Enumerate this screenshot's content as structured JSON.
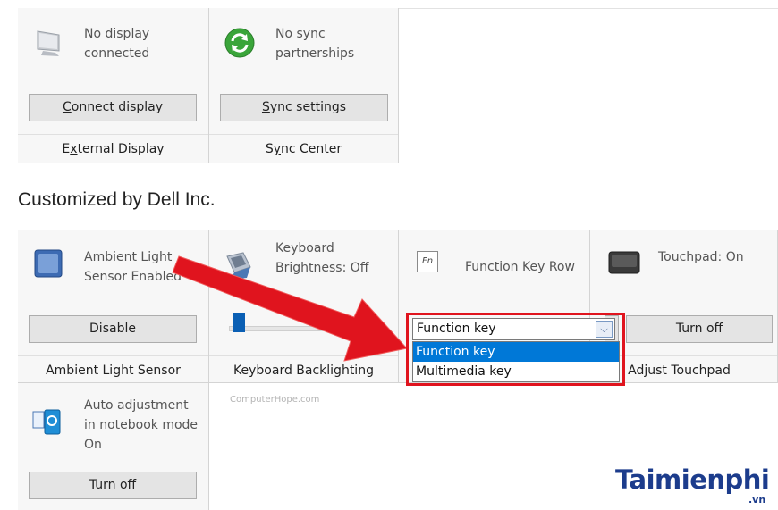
{
  "top_row": [
    {
      "status": "No display connected",
      "button": "Connect display",
      "button_access_key": "C",
      "name": "External Display",
      "name_access_key": "x",
      "icon": "monitor-icon"
    },
    {
      "status": "No sync partnerships",
      "button": "Sync settings",
      "button_access_key": "S",
      "name": "Sync Center",
      "name_access_key": "y",
      "icon": "sync-icon"
    }
  ],
  "section_title": "Customized by Dell Inc.",
  "dell_tiles": {
    "ambient": {
      "status": "Ambient Light Sensor Enabled",
      "button": "Disable",
      "name": "Ambient Light Sensor",
      "icon": "light-sensor-icon"
    },
    "keyboard": {
      "status": "Keyboard Brightness: Off",
      "name": "Keyboard Backlighting",
      "brightness_level": 0.05,
      "icon": "keyboard-icon"
    },
    "fnrow": {
      "status": "Function Key Row",
      "icon": "fn-key-icon",
      "icon_text": "Fn",
      "dropdown": {
        "selected": "Function key",
        "options": [
          "Function key",
          "Multimedia key"
        ],
        "highlighted": "Function key"
      }
    },
    "touchpad": {
      "status": "Touchpad: On",
      "button": "Turn off",
      "name": "Adjust Touchpad",
      "icon": "touchpad-icon"
    },
    "notebook": {
      "status": "Auto adjustment in notebook mode On",
      "button": "Turn off",
      "icon": "notebook-mode-icon"
    }
  },
  "watermark": "ComputerHope.com",
  "brand": {
    "text": "Taimienphi",
    "suffix": ".vn"
  },
  "colors": {
    "highlight": "#0078d7",
    "callout": "#e0141e",
    "brand": "#1c3c8c"
  }
}
